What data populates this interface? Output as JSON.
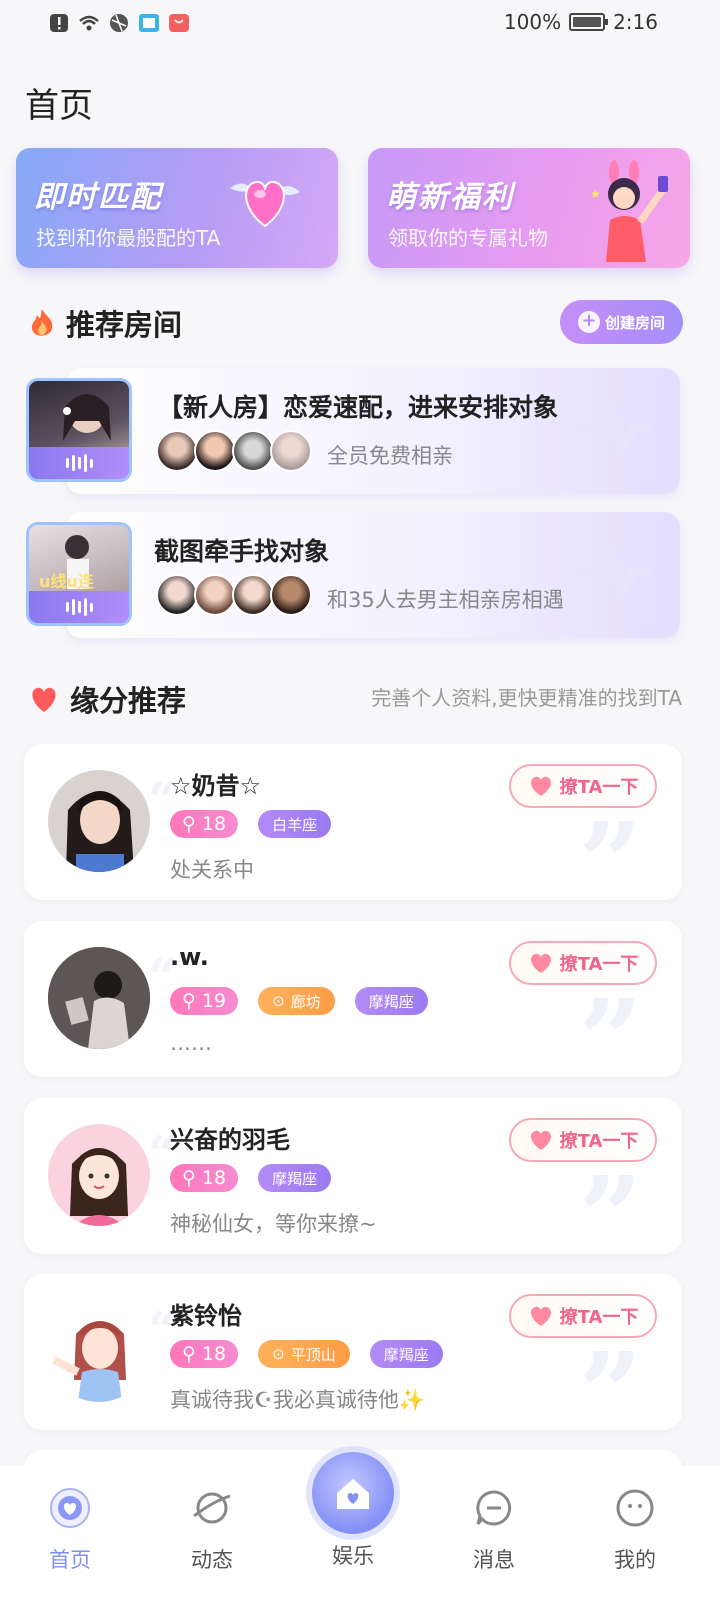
{
  "status_bar": {
    "battery": "100%",
    "time": "2:16"
  },
  "page_title": "首页",
  "banners": [
    {
      "title": "即时匹配",
      "subtitle": "找到和你最般配的TA"
    },
    {
      "title": "萌新福利",
      "subtitle": "领取你的专属礼物"
    }
  ],
  "rooms_section": {
    "title": "推荐房间",
    "create_label": "创建房间"
  },
  "rooms": [
    {
      "title": "【新人房】恋爱速配，进来安排对象",
      "desc": "全员免费相亲"
    },
    {
      "title": "截图牵手找对象",
      "desc": "和35人去男主相亲房相遇"
    }
  ],
  "fate_section": {
    "title": "缘分推荐",
    "hint": "完善个人资料,更快更精准的找到TA"
  },
  "users": [
    {
      "name": "☆奶昔☆",
      "age": "18",
      "city": "",
      "zodiac": "白羊座",
      "sign": "处关系中",
      "button": "撩TA一下"
    },
    {
      "name": ".w.",
      "age": "19",
      "city": "廊坊",
      "zodiac": "摩羯座",
      "sign": "……",
      "button": "撩TA一下"
    },
    {
      "name": "兴奋的羽毛",
      "age": "18",
      "city": "",
      "zodiac": "摩羯座",
      "sign": "神秘仙女，等你来撩~",
      "button": "撩TA一下"
    },
    {
      "name": "紫铃怡",
      "age": "18",
      "city": "平顶山",
      "zodiac": "摩羯座",
      "sign": "真诚待我☪我必真诚待他✨",
      "button": "撩TA一下"
    }
  ],
  "bottom_nav": [
    {
      "label": "首页",
      "icon": "home-icon",
      "active": true
    },
    {
      "label": "动态",
      "icon": "planet-icon",
      "active": false
    },
    {
      "label": "娱乐",
      "icon": "house-heart-icon",
      "active": false
    },
    {
      "label": "消息",
      "icon": "message-icon",
      "active": false
    },
    {
      "label": "我的",
      "icon": "profile-icon",
      "active": false
    }
  ],
  "colors": {
    "accent": "#8390f5",
    "pink": "#f0648d",
    "purple": "#b58af7"
  }
}
